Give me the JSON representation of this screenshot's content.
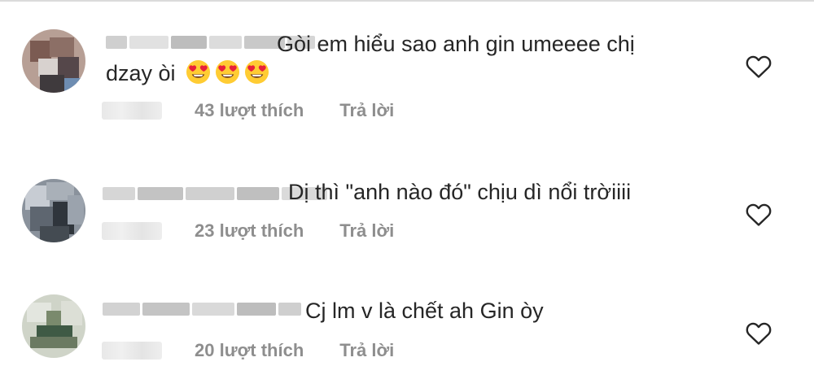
{
  "comments": [
    {
      "text_line1": "Gòi em hiểu sao anh gin umeeee chị",
      "text_line2": "dzay òi",
      "emojis": [
        "heart-eyes",
        "heart-eyes",
        "heart-eyes"
      ],
      "likes": "43 lượt thích",
      "reply": "Trả lời"
    },
    {
      "text_line1": "Dị thì \"anh nào đó\" chịu dì nổi trờiiii",
      "likes": "23 lượt thích",
      "reply": "Trả lời"
    },
    {
      "text_line1": "Cj lm v là chết ah Gin òy",
      "likes": "20 lượt thích",
      "reply": "Trả lời"
    }
  ],
  "colors": {
    "text": "#262626",
    "meta": "#8e8e8e",
    "divider": "#dbdbdb"
  }
}
